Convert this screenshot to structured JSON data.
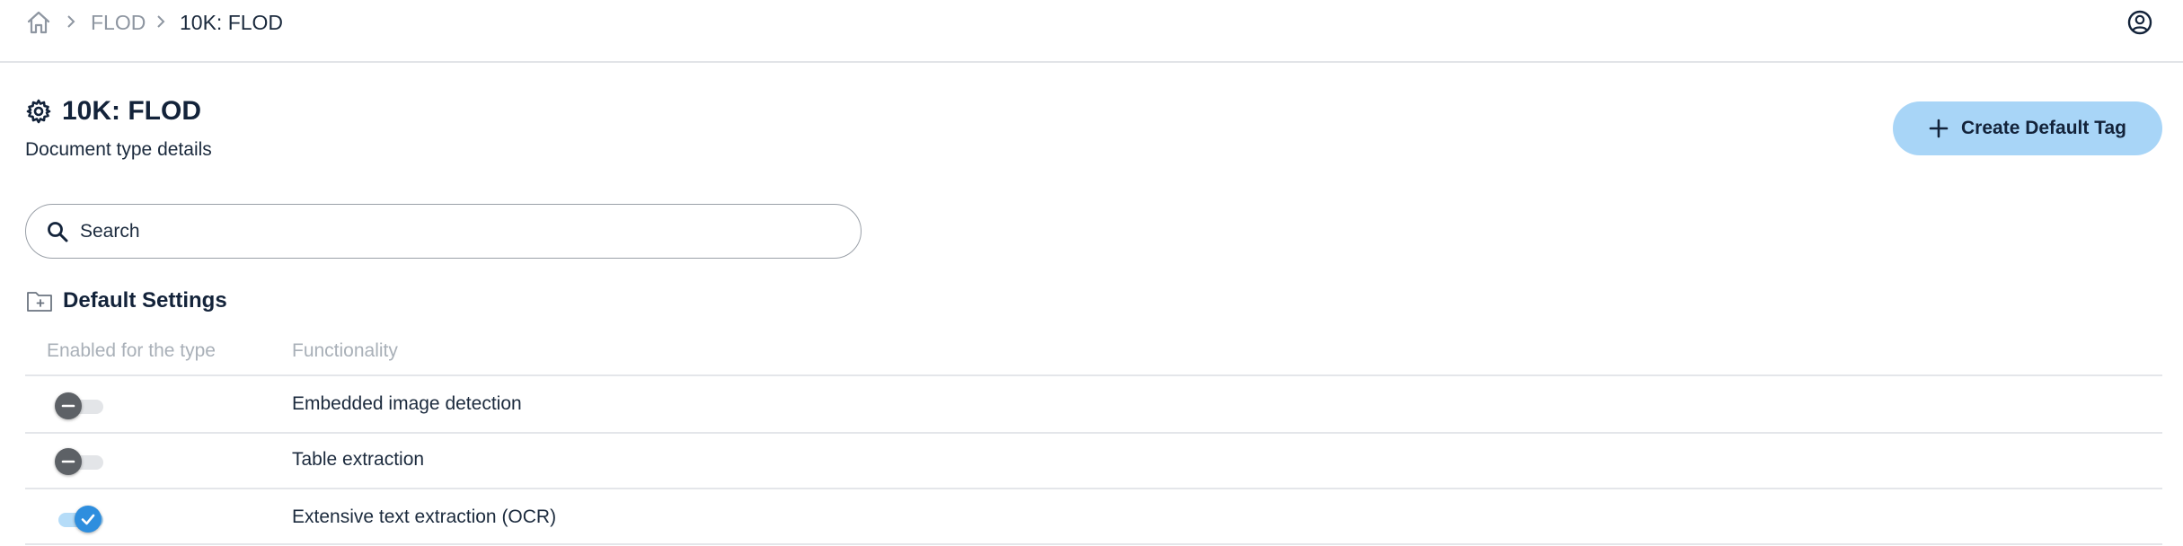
{
  "breadcrumb": {
    "home_icon": "home-icon",
    "items": [
      {
        "label": "FLOD"
      },
      {
        "label": "10K: FLOD"
      }
    ]
  },
  "user_icon": "user-circle-icon",
  "header": {
    "title": "10K: FLOD",
    "subtitle": "Document type details",
    "title_icon": "gear-icon"
  },
  "actions": {
    "create_default_tag": "Create Default Tag"
  },
  "search": {
    "placeholder": "Search",
    "value": ""
  },
  "section": {
    "title": "Default Settings",
    "icon": "folder-add-icon"
  },
  "table": {
    "columns": [
      "Enabled for the type",
      "Functionality"
    ],
    "rows": [
      {
        "enabled": false,
        "functionality": "Embedded image detection"
      },
      {
        "enabled": false,
        "functionality": "Table extraction"
      },
      {
        "enabled": true,
        "functionality": "Extensive text extraction (OCR)"
      }
    ]
  },
  "colors": {
    "accent": "#2e8ede",
    "button_bg": "#a8d5f7",
    "text_primary": "#1b2a3d",
    "text_muted": "#a9b0b8",
    "toggle_off_knob": "#5d6166"
  }
}
